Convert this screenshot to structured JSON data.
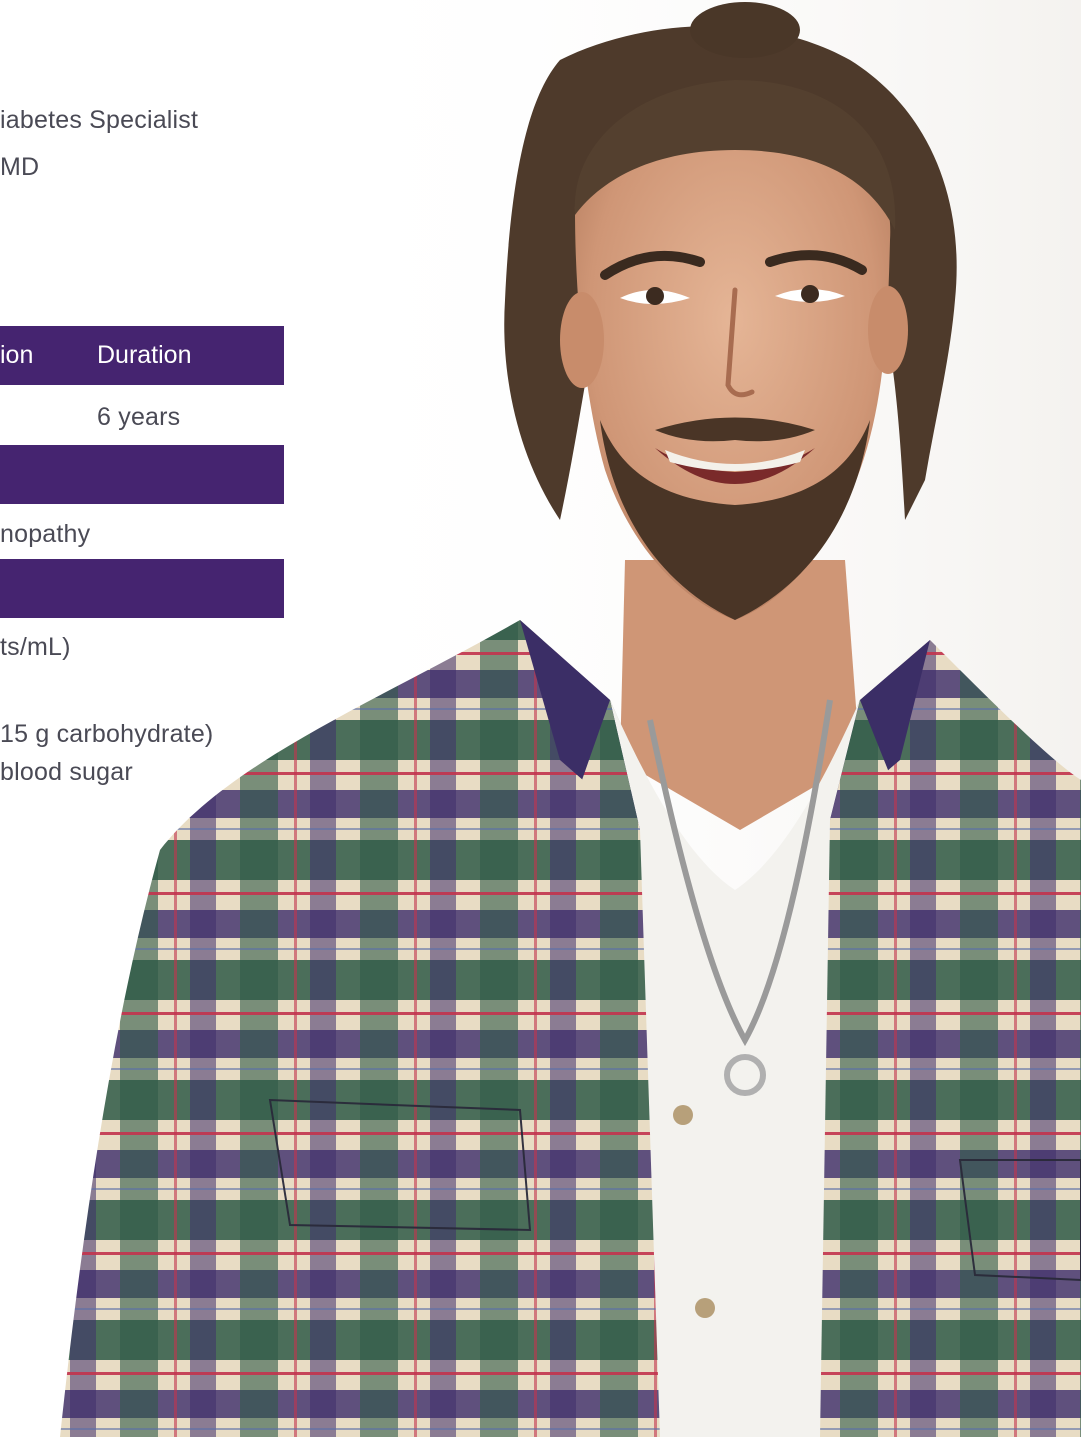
{
  "header": {
    "line1": "iabetes Specialist",
    "line2": "MD"
  },
  "table": {
    "header_col1": "ion",
    "header_col2": "Duration",
    "row1_col2": "6 years",
    "row2_text": "nopathy",
    "row3_text": "ts/mL)"
  },
  "notes": {
    "line1": "15 g carbohydrate)",
    "line2": "blood sugar"
  },
  "colors": {
    "band": "#452470",
    "text": "#4a4a55",
    "background": "#ffffff"
  },
  "photo": {
    "subject": "smiling man with long hair tied back and beard wearing plaid flannel shirt over white t-shirt with chain necklace"
  }
}
